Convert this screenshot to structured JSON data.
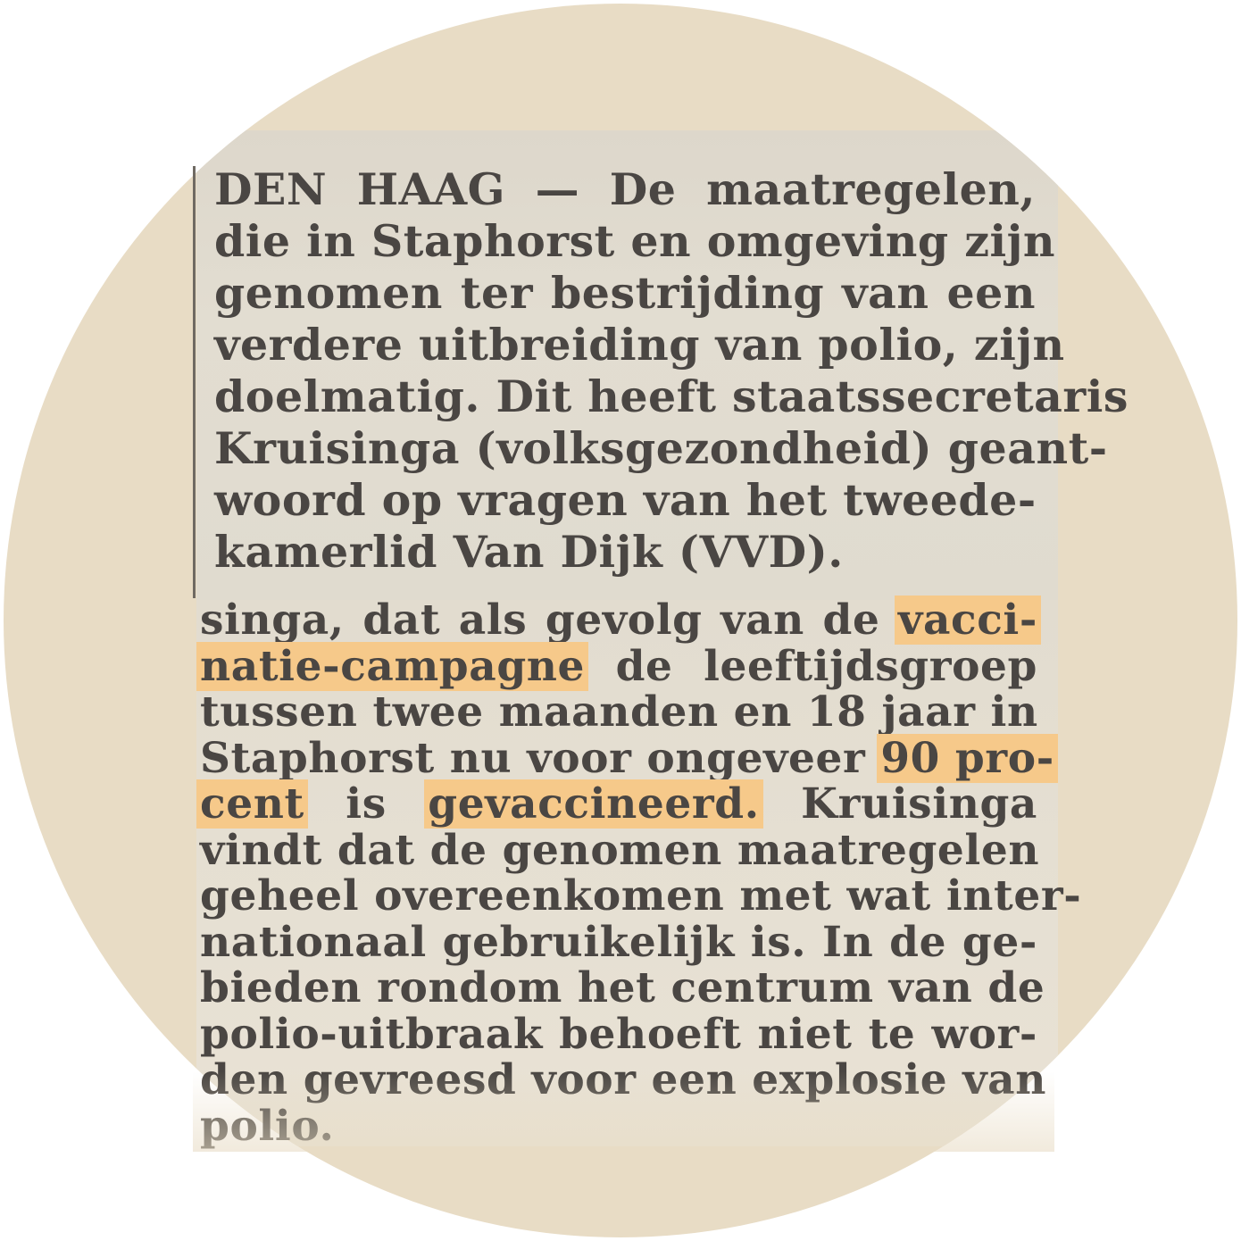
{
  "article": {
    "paragraph_1": [
      "DEN HAAG — De maatregelen,",
      "die in Staphorst en omgeving zijn",
      "genomen ter bestrijding van een",
      "verdere uitbreiding van polio, zijn",
      "doelmatig. Dit heeft staatssecretaris",
      "Kruisinga (volksgezondheid) geant-",
      "woord op vragen van het tweede-",
      "kamerlid Van Dijk (VVD)."
    ],
    "paragraph_2": {
      "line_1_before": "singa, dat als gevolg van de ",
      "line_1_highlight": "vacci-",
      "line_2_highlight": "natie-campagne",
      "line_2_after": " de leeftijdsgroep",
      "line_3": "tussen twee maanden en 18 jaar in",
      "line_4_before": "Staphorst nu voor ongeveer ",
      "line_4_highlight": "90 pro-",
      "line_5_highlight_a": "cent",
      "line_5_middle": " is ",
      "line_5_highlight_b": "gevaccineerd.",
      "line_5_after": " Kruisinga",
      "line_6": "vindt dat de genomen maatregelen",
      "line_7": "geheel overeenkomen met wat inter-",
      "line_8": "nationaal gebruikelijk is. In de ge-",
      "line_9": "bieden rondom het centrum van de",
      "line_10": "polio-uitbraak behoeft niet te wor-",
      "line_11": "den gevreesd voor een explosie van",
      "line_12": "polio."
    }
  },
  "colors": {
    "background_circle": "#e8dcc5",
    "paper": "#e3ddd0",
    "ink": "#4a4643",
    "highlight": "#f6c98a"
  }
}
